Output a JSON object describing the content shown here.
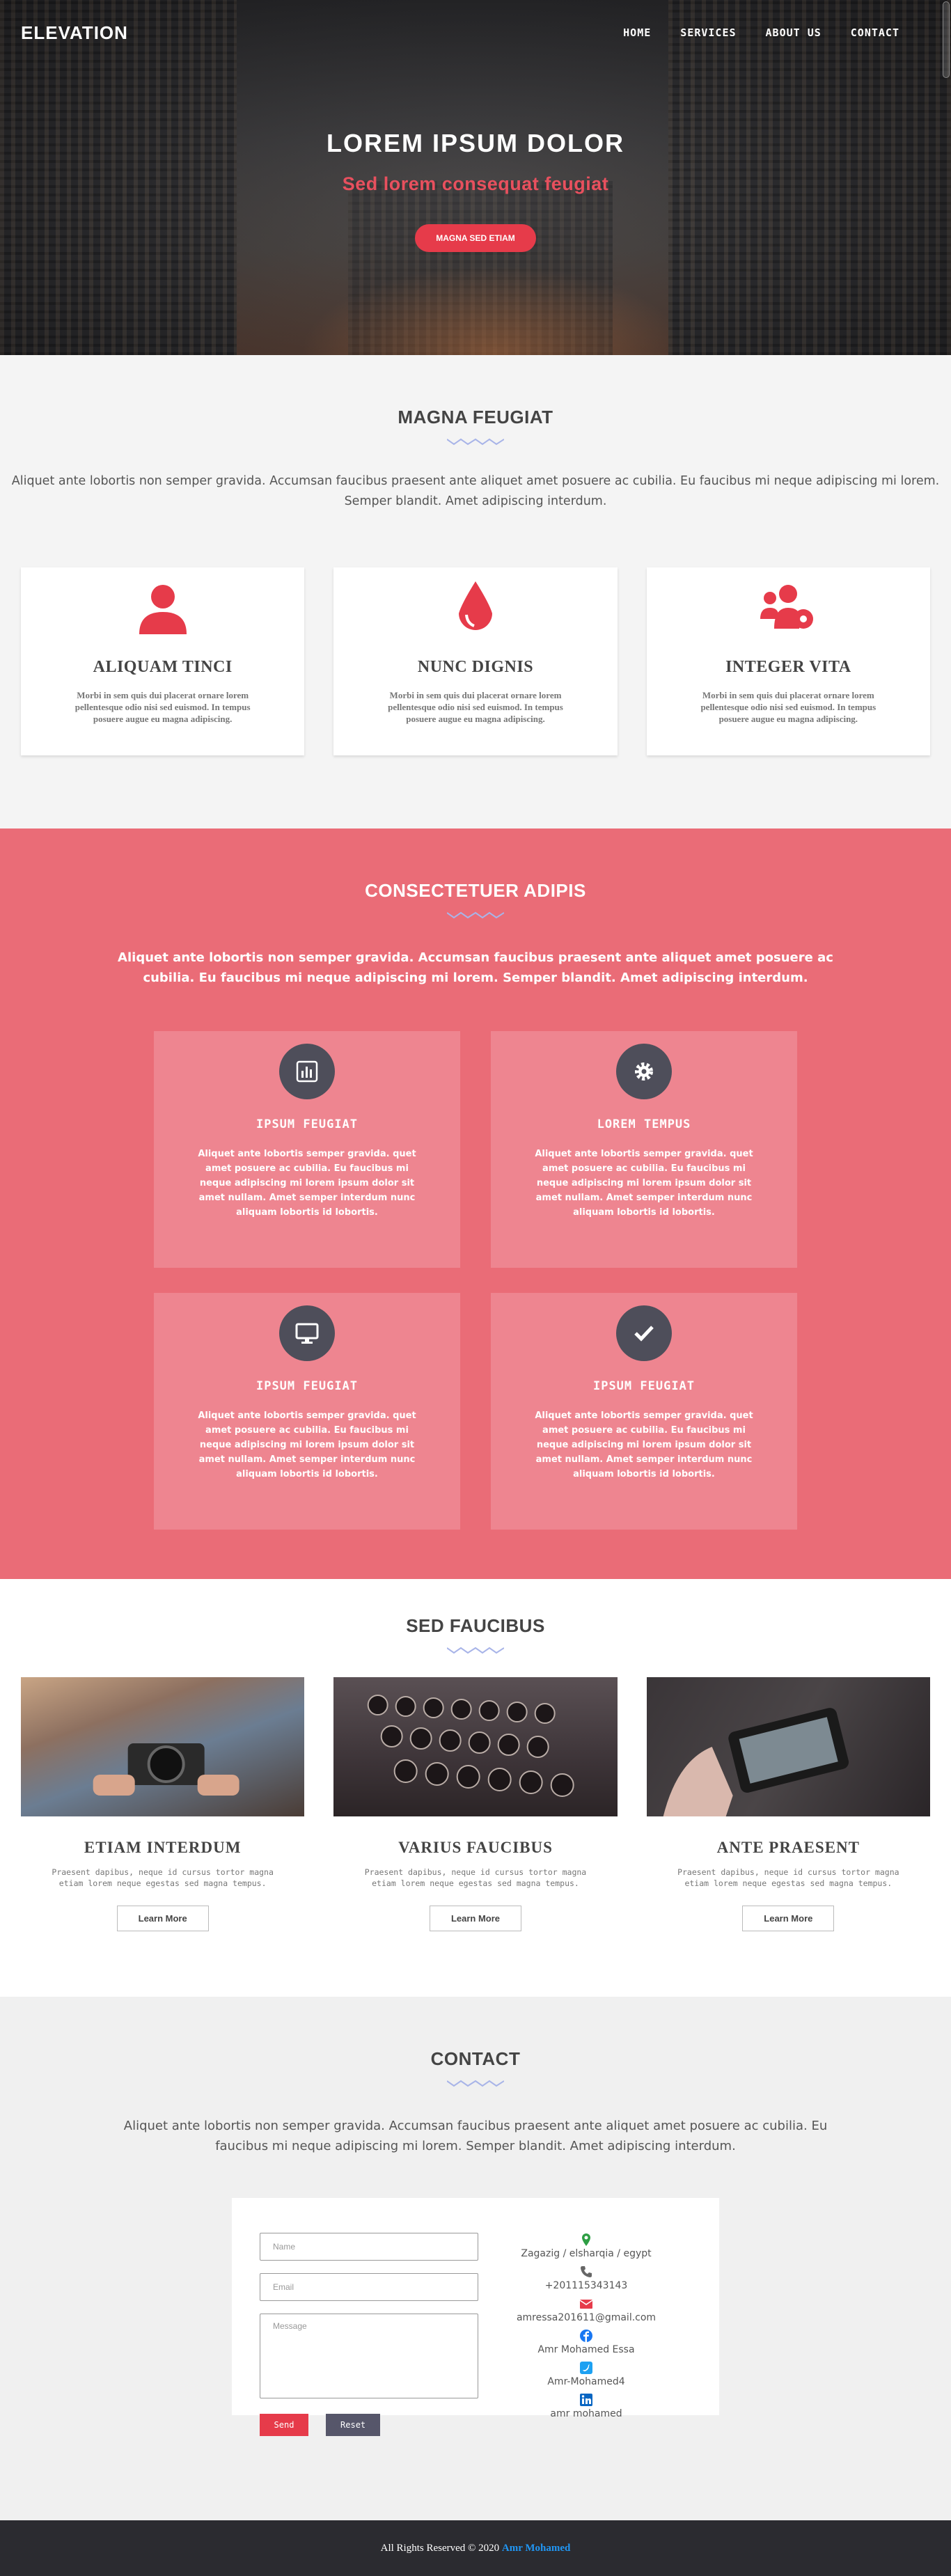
{
  "brand": "ELEVATION",
  "nav": [
    "HOME",
    "SERVICES",
    "ABOUT US",
    "CONTACT"
  ],
  "hero": {
    "title": "LOREM IPSUM DOLOR",
    "subtitle": "Sed lorem consequat feugiat",
    "button": "MAGNA SED ETIAM"
  },
  "colors": {
    "accent": "#e63b4a",
    "pink_section": "#ea6c77",
    "dark": "#4e4e5a",
    "footer": "#2b2b30",
    "link": "#2196f3"
  },
  "intro": {
    "title": "MAGNA FEUGIAT",
    "text": "Aliquet ante lobortis non semper gravida. Accumsan faucibus praesent ante aliquet amet posuere ac cubilia. Eu faucibus mi neque adipiscing mi lorem. Semper blandit. Amet adipiscing interdum.",
    "cards": [
      {
        "icon": "user-icon",
        "title": "ALIQUAM TINCI",
        "text": "Morbi in sem quis dui placerat ornare lorem pellentesque odio nisi sed euismod. In tempus posuere augue eu magna adipiscing."
      },
      {
        "icon": "drop-icon",
        "title": "NUNC DIGNIS",
        "text": "Morbi in sem quis dui placerat ornare lorem pellentesque odio nisi sed euismod. In tempus posuere augue eu magna adipiscing."
      },
      {
        "icon": "users-cog-icon",
        "title": "INTEGER VITA",
        "text": "Morbi in sem quis dui placerat ornare lorem pellentesque odio nisi sed euismod. In tempus posuere augue eu magna adipiscing."
      }
    ]
  },
  "features": {
    "title": "CONSECTETUER ADIPIS",
    "text": "Aliquet ante lobortis non semper gravida. Accumsan faucibus praesent ante aliquet amet posuere ac cubilia. Eu faucibus mi neque adipiscing mi lorem. Semper blandit. Amet adipiscing interdum.",
    "items": [
      {
        "icon": "chart-icon",
        "title": "IPSUM FEUGIAT",
        "text": "Aliquet ante lobortis semper gravida. quet amet posuere ac cubilia. Eu faucibus mi neque adipiscing mi lorem ipsum dolor sit amet nullam. Amet semper interdum nunc aliquam lobortis id lobortis."
      },
      {
        "icon": "gear-icon",
        "title": "LOREM TEMPUS",
        "text": "Aliquet ante lobortis semper gravida. quet amet posuere ac cubilia. Eu faucibus mi neque adipiscing mi lorem ipsum dolor sit amet nullam. Amet semper interdum nunc aliquam lobortis id lobortis."
      },
      {
        "icon": "monitor-icon",
        "title": "IPSUM FEUGIAT",
        "text": "Aliquet ante lobortis semper gravida. quet amet posuere ac cubilia. Eu faucibus mi neque adipiscing mi lorem ipsum dolor sit amet nullam. Amet semper interdum nunc aliquam lobortis id lobortis."
      },
      {
        "icon": "check-icon",
        "title": "IPSUM FEUGIAT",
        "text": "Aliquet ante lobortis semper gravida. quet amet posuere ac cubilia. Eu faucibus mi neque adipiscing mi lorem ipsum dolor sit amet nullam. Amet semper interdum nunc aliquam lobortis id lobortis."
      }
    ]
  },
  "gallery": {
    "title": "SED FAUCIBUS",
    "items": [
      {
        "title": "ETIAM INTERDUM",
        "text": "Praesent dapibus, neque id cursus tortor magna etiam lorem neque egestas sed magna tempus.",
        "button": "Learn More"
      },
      {
        "title": "VARIUS FAUCIBUS",
        "text": "Praesent dapibus, neque id cursus tortor magna etiam lorem neque egestas sed magna tempus.",
        "button": "Learn More"
      },
      {
        "title": "ANTE PRAESENT",
        "text": "Praesent dapibus, neque id cursus tortor magna etiam lorem neque egestas sed magna tempus.",
        "button": "Learn More"
      }
    ]
  },
  "contact": {
    "title": "CONTACT",
    "text": "Aliquet ante lobortis non semper gravida. Accumsan faucibus praesent ante aliquet amet posuere ac cubilia. Eu faucibus mi neque adipiscing mi lorem. Semper blandit. Amet adipiscing interdum.",
    "form": {
      "name_placeholder": "Name",
      "email_placeholder": "Email",
      "message_placeholder": "Message",
      "send": "Send",
      "reset": "Reset"
    },
    "info": [
      {
        "icon": "location-icon",
        "text": "Zagazig / elsharqia / egypt"
      },
      {
        "icon": "phone-icon",
        "text": "+201115343143"
      },
      {
        "icon": "envelope-icon",
        "text": "amressa201611@gmail.com"
      },
      {
        "icon": "facebook-icon",
        "text": "Amr Mohamed Essa"
      },
      {
        "icon": "twitter-icon",
        "text": "Amr-Mohamed4"
      },
      {
        "icon": "linkedin-icon",
        "text": "amr mohamed"
      }
    ]
  },
  "footer": {
    "text": "All Rights Reserved © 2020",
    "author": "Amr Mohamed"
  }
}
